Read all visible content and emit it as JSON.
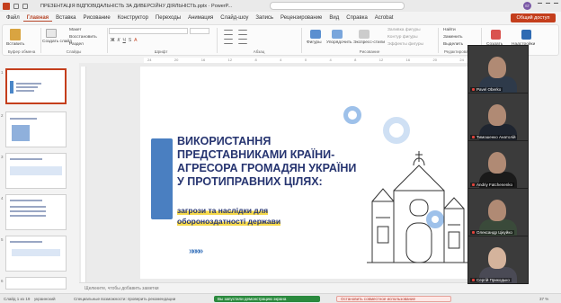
{
  "window": {
    "title": "ПРЕЗЕНТАЦІЯ ВІДПОВІДАЛЬНІСТЬ ЗА ДИВЕРСІЙНУ ДІЯЛЬНІСТЬ.pptx  ·  PowerP...",
    "avatar_initials": "ST"
  },
  "menu": {
    "tabs": [
      "Файл",
      "Главная",
      "Вставка",
      "Рисование",
      "Конструктор",
      "Переходы",
      "Анимация",
      "Слайд-шоу",
      "Запись",
      "Рецензирование",
      "Вид",
      "Справка",
      "Acrobat"
    ],
    "active": "Главная",
    "share_label": "Общий доступ"
  },
  "ribbon": {
    "paste_label": "Вставить",
    "clipboard_group": "Буфер обмена",
    "new_slide_label": "Создать слайд",
    "reuse_label": "Повторно",
    "layout_label": "Макет",
    "reset_label": "Восстановить",
    "section_label": "Раздел",
    "slides_group": "Слайды",
    "font_group": "Шрифт",
    "paragraph_group": "Абзац",
    "shapes_label": "Фигуры",
    "arrange_label": "Упорядочить",
    "styles_label": "Экспресс-стили",
    "fill_label": "Заливка фигуры",
    "outline_label": "Контур фигуры",
    "effects_label": "Эффекты фигуры",
    "drawing_group": "Рисование",
    "find_label": "Найти",
    "replace_label": "Заменить",
    "select_label": "Выделить",
    "editing_group": "Редактирование",
    "create_label": "Создать",
    "addins_label": "Надстройки"
  },
  "ruler_ticks": [
    "24",
    "22",
    "20",
    "18",
    "16",
    "14",
    "12",
    "10",
    "8",
    "6",
    "4",
    "2",
    "0",
    "2",
    "4",
    "6",
    "8",
    "10",
    "12",
    "14",
    "16",
    "18",
    "20",
    "22",
    "24"
  ],
  "thumbnails": [
    {
      "num": "1",
      "active": true
    },
    {
      "num": "2",
      "active": false
    },
    {
      "num": "3",
      "active": false
    },
    {
      "num": "4",
      "active": false
    },
    {
      "num": "5",
      "active": false
    },
    {
      "num": "6",
      "active": false
    }
  ],
  "slide": {
    "title": "ВИКОРИСТАННЯ ПРЕДСТАВНИКАМИ КРАЇНИ-АГРЕСОРА ГРОМАДЯН УКРАЇНИ У ПРОТИПРАВНИХ ЦІЛЯХ:",
    "subtitle": "загрози та наслідки для обороноздатності держави",
    "chevrons": "»»»»"
  },
  "notes_placeholder": "Щелкните, чтобы добавить заметки",
  "participants": [
    {
      "name": "Pavel Oberko",
      "body": "#2e3a4a"
    },
    {
      "name": "Тимошенко Анатолій",
      "body": "#1f2530"
    },
    {
      "name": "Andriy Fatchenenko",
      "body": "#1a1a1a"
    },
    {
      "name": "Олександр Цікуйко",
      "body": "#3a4a3a"
    },
    {
      "name": "Сергій Прикодько",
      "body": "#4a4a55"
    }
  ],
  "status": {
    "slide_info": "Слайд 1 из 19",
    "language": "украинский",
    "accessibility": "Специальные возможности: проверить рекомендации",
    "sharing_banner": "Вы запустили демонстрацию экрана",
    "stop_banner": "Остановить совместное использование",
    "zoom": "37 %"
  },
  "colors": {
    "accent": "#c43e1c",
    "slide_title": "#263470",
    "slide_blue": "#4a7fc1",
    "highlight": "#f5d84a"
  }
}
